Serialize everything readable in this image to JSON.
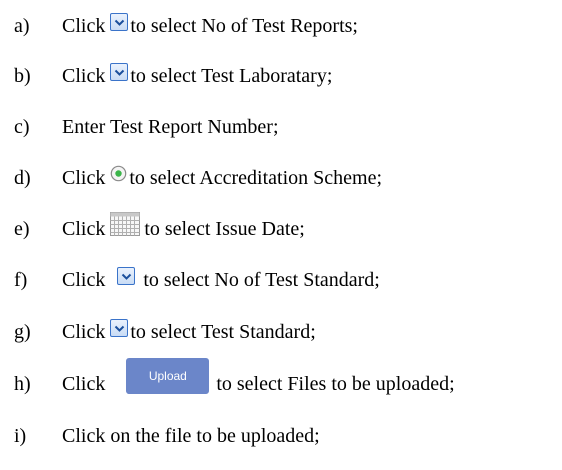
{
  "steps": [
    {
      "letter": "a)",
      "pre": "Click",
      "icon": "dropdown-icon",
      "post": "to select No of Test Reports;"
    },
    {
      "letter": "b)",
      "pre": "Click",
      "icon": "dropdown-icon",
      "post": "to select Test Laboratary;"
    },
    {
      "letter": "c)",
      "text": "Enter Test Report Number;"
    },
    {
      "letter": "d)",
      "pre": "Click",
      "icon": "radio-selected-icon",
      "post": "to select Accreditation Scheme;"
    },
    {
      "letter": "e)",
      "pre": "Click",
      "icon": "calendar-icon",
      "post": "to select Issue Date;"
    },
    {
      "letter": "f)",
      "pre": "Click",
      "icon": "dropdown-icon",
      "post": "to select No of Test Standard;"
    },
    {
      "letter": "g)",
      "pre": "Click",
      "icon": "dropdown-icon",
      "post": "to select Test Standard;"
    },
    {
      "letter": "h)",
      "pre": "Click",
      "button_label": "Upload",
      "post": "to select Files to be uploaded;"
    },
    {
      "letter": "i)",
      "text": "Click on the file to be uploaded;"
    }
  ],
  "colors": {
    "dropdown_border": "#3a73c9",
    "upload_button": "#6b86c9",
    "radio_dot": "#3bb54a"
  }
}
